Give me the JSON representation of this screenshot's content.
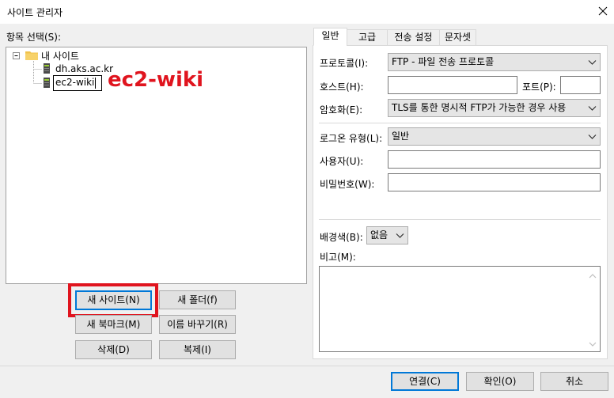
{
  "window": {
    "title": "사이트 관리자"
  },
  "left": {
    "tree_label": "항목 선택(S):",
    "tree": {
      "root": "내 사이트",
      "children": [
        "dh.aks.ac.kr",
        "ec2-wiki"
      ]
    },
    "annotation": "ec2-wiki",
    "buttons": {
      "new_site": "새 사이트(N)",
      "new_folder": "새 폴더(f)",
      "new_bookmark": "새 북마크(M)",
      "rename": "이름 바꾸기(R)",
      "delete": "삭제(D)",
      "duplicate": "복제(I)"
    }
  },
  "tabs": [
    "일반",
    "고급",
    "전송 설정",
    "문자셋"
  ],
  "general": {
    "protocol_label": "프로토콜(I):",
    "protocol_value": "FTP - 파일 전송 프로토콜",
    "host_label": "호스트(H):",
    "host_value": "",
    "port_label": "포트(P):",
    "port_value": "",
    "encryption_label": "암호화(E):",
    "encryption_value": "TLS를 통한 명시적 FTP가 가능한 경우 사용",
    "logon_label": "로그온 유형(L):",
    "logon_value": "일반",
    "user_label": "사용자(U):",
    "user_value": "",
    "password_label": "비밀번호(W):",
    "password_value": "",
    "bgcolor_label": "배경색(B):",
    "bgcolor_value": "없음",
    "comments_label": "비고(M):",
    "comments_value": ""
  },
  "footer": {
    "connect": "연결(C)",
    "ok": "확인(O)",
    "cancel": "취소"
  },
  "colors": {
    "highlight": "#e0141e",
    "focus": "#0078d7",
    "folder": "#f0c14b"
  }
}
